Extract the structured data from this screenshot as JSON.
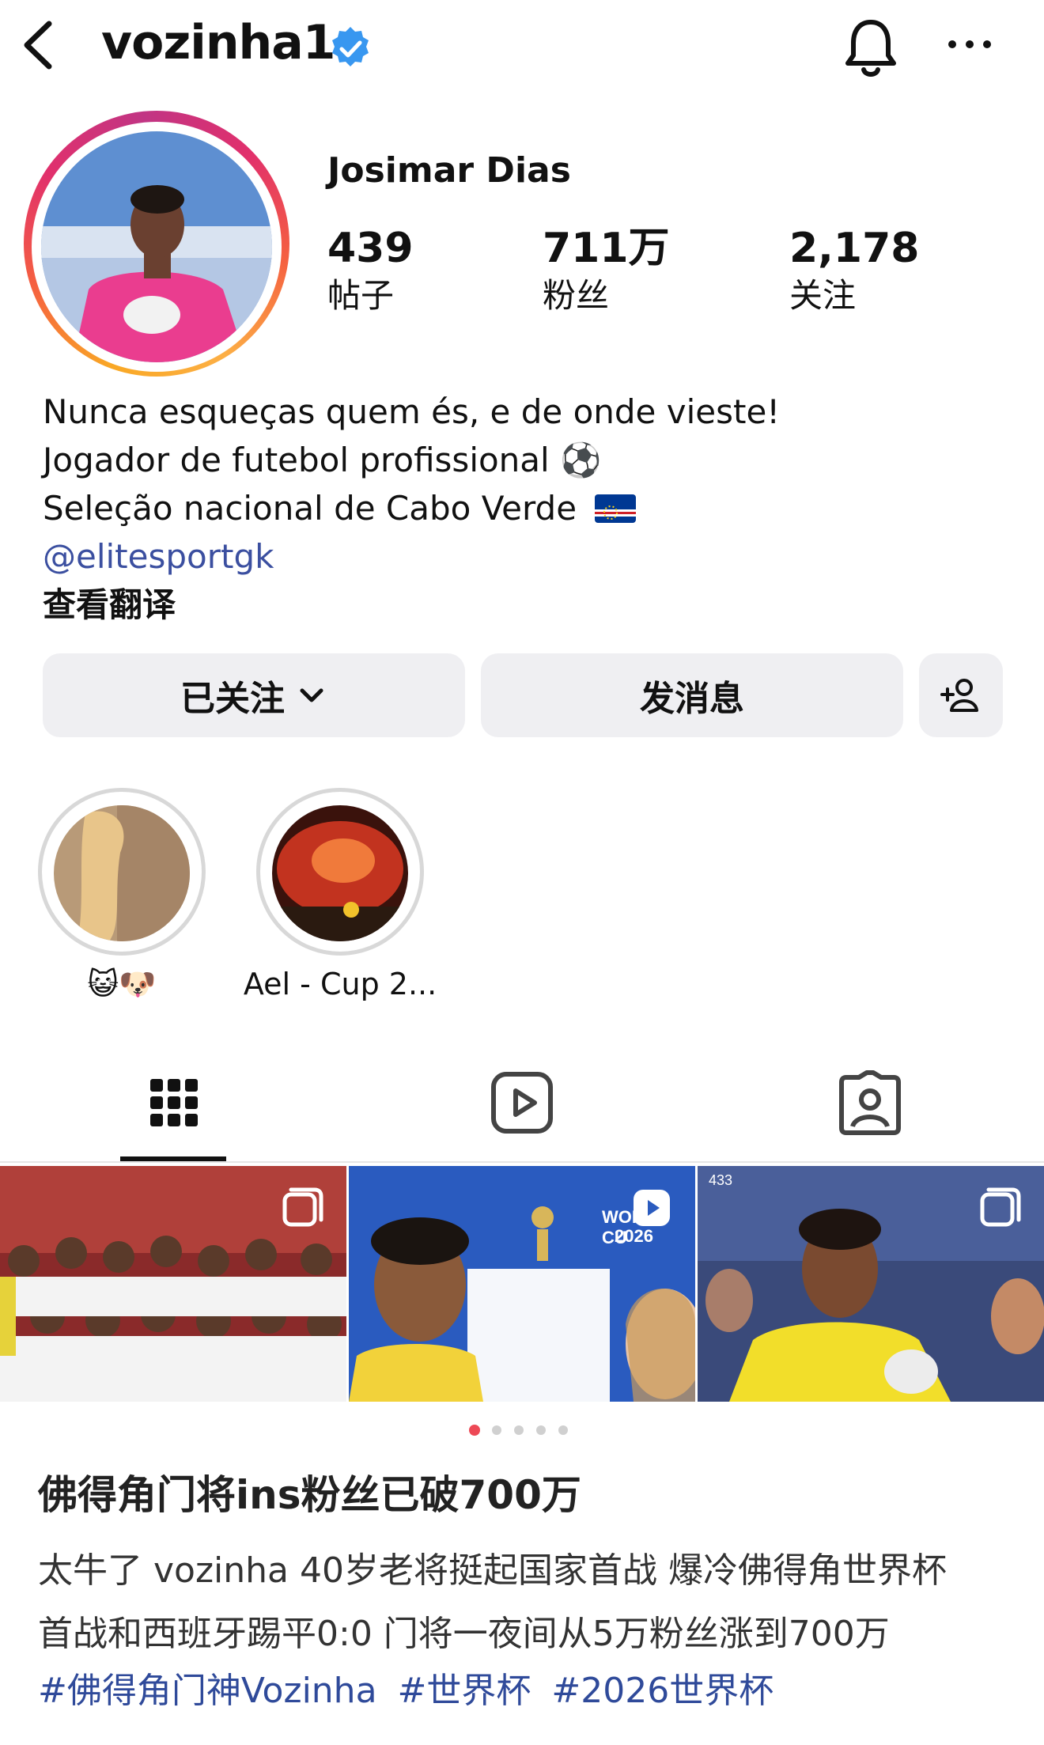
{
  "header": {
    "username": "vozinha1",
    "back_icon": "chevron-left-icon",
    "verified_icon": "verified-badge-icon",
    "bell_icon": "bell-icon",
    "more_icon": "ellipsis-icon"
  },
  "profile": {
    "full_name": "Josimar Dias",
    "stats": [
      {
        "value": "439",
        "label": "帖子"
      },
      {
        "value": "711万",
        "label": "粉丝"
      },
      {
        "value": "2,178",
        "label": "关注"
      }
    ],
    "bio": {
      "line1": "Nunca esqueças quem és, e de onde vieste!",
      "line2": "Jogador de futebol profissional ⚽",
      "line3": "Seleção nacional de Cabo Verde",
      "link": "@elitesportgk",
      "translate": "查看翻译"
    }
  },
  "actions": {
    "following_label": "已关注",
    "message_label": "发消息",
    "add_person_icon": "add-person-icon"
  },
  "highlights": [
    {
      "label": "😺🐶"
    },
    {
      "label": "Ael - Cup 2..."
    }
  ],
  "tabs": [
    "grid-icon",
    "reels-icon",
    "tagged-icon"
  ],
  "post_overlays": {
    "post2_logo_text": "WORLD CU",
    "post2_year": "2026",
    "post3_corner": "433"
  },
  "carousel": {
    "count": 5,
    "active": 0
  },
  "article": {
    "title": "佛得角门将ins粉丝已破700万",
    "desc_line1": "太牛了 vozinha 40岁老将挺起国家首战 爆冷佛得角世界杯",
    "desc_line2": "首战和西班牙踢平0:0  门将一夜间从5万粉丝涨到700万",
    "hashtags": [
      "#佛得角门神Vozinha",
      "#世界杯",
      "#2026世界杯"
    ]
  },
  "colors": {
    "link": "#3b4fa0",
    "hashtag": "#2f4a9a",
    "verified": "#3897f0",
    "active_dot": "#ed4956"
  }
}
